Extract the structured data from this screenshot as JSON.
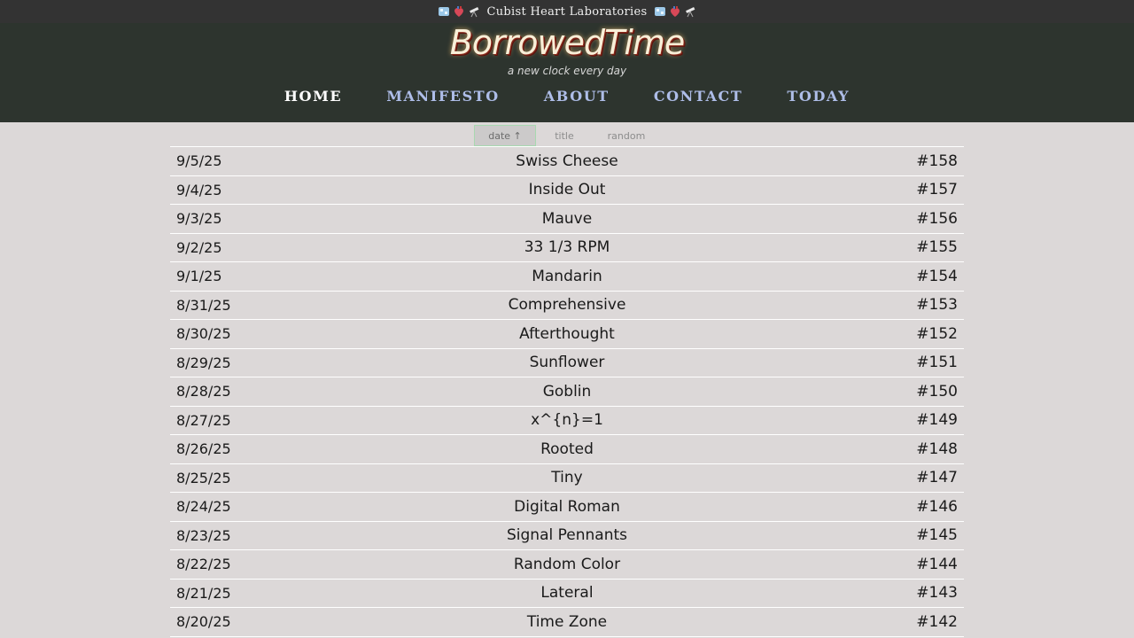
{
  "topbar": {
    "left_icons": [
      "ice-cube-icon",
      "anatomical-heart-icon",
      "telescope-icon"
    ],
    "lab_name": "Cubist Heart Laboratories",
    "right_icons": [
      "ice-cube-icon",
      "anatomical-heart-icon",
      "telescope-icon"
    ]
  },
  "header": {
    "logo": "BorrowedTime",
    "tagline": "a new clock every day"
  },
  "nav": {
    "home": "HOME",
    "manifesto": "MANIFESTO",
    "about": "ABOUT",
    "contact": "CONTACT",
    "today": "TODAY"
  },
  "sort": {
    "date": "date ↑",
    "title": "title",
    "random": "random"
  },
  "clocks": [
    {
      "date": "9/5/25",
      "title": "Swiss Cheese",
      "num": "#158"
    },
    {
      "date": "9/4/25",
      "title": "Inside Out",
      "num": "#157"
    },
    {
      "date": "9/3/25",
      "title": "Mauve",
      "num": "#156"
    },
    {
      "date": "9/2/25",
      "title": "33 1/3 RPM",
      "num": "#155"
    },
    {
      "date": "9/1/25",
      "title": "Mandarin",
      "num": "#154"
    },
    {
      "date": "8/31/25",
      "title": "Comprehensive",
      "num": "#153"
    },
    {
      "date": "8/30/25",
      "title": "Afterthought",
      "num": "#152"
    },
    {
      "date": "8/29/25",
      "title": "Sunflower",
      "num": "#151"
    },
    {
      "date": "8/28/25",
      "title": "Goblin",
      "num": "#150"
    },
    {
      "date": "8/27/25",
      "title": "x^{n}=1",
      "num": "#149"
    },
    {
      "date": "8/26/25",
      "title": "Rooted",
      "num": "#148"
    },
    {
      "date": "8/25/25",
      "title": "Tiny",
      "num": "#147"
    },
    {
      "date": "8/24/25",
      "title": "Digital Roman",
      "num": "#146"
    },
    {
      "date": "8/23/25",
      "title": "Signal Pennants",
      "num": "#145"
    },
    {
      "date": "8/22/25",
      "title": "Random Color",
      "num": "#144"
    },
    {
      "date": "8/21/25",
      "title": "Lateral",
      "num": "#143"
    },
    {
      "date": "8/20/25",
      "title": "Time Zone",
      "num": "#142"
    }
  ]
}
